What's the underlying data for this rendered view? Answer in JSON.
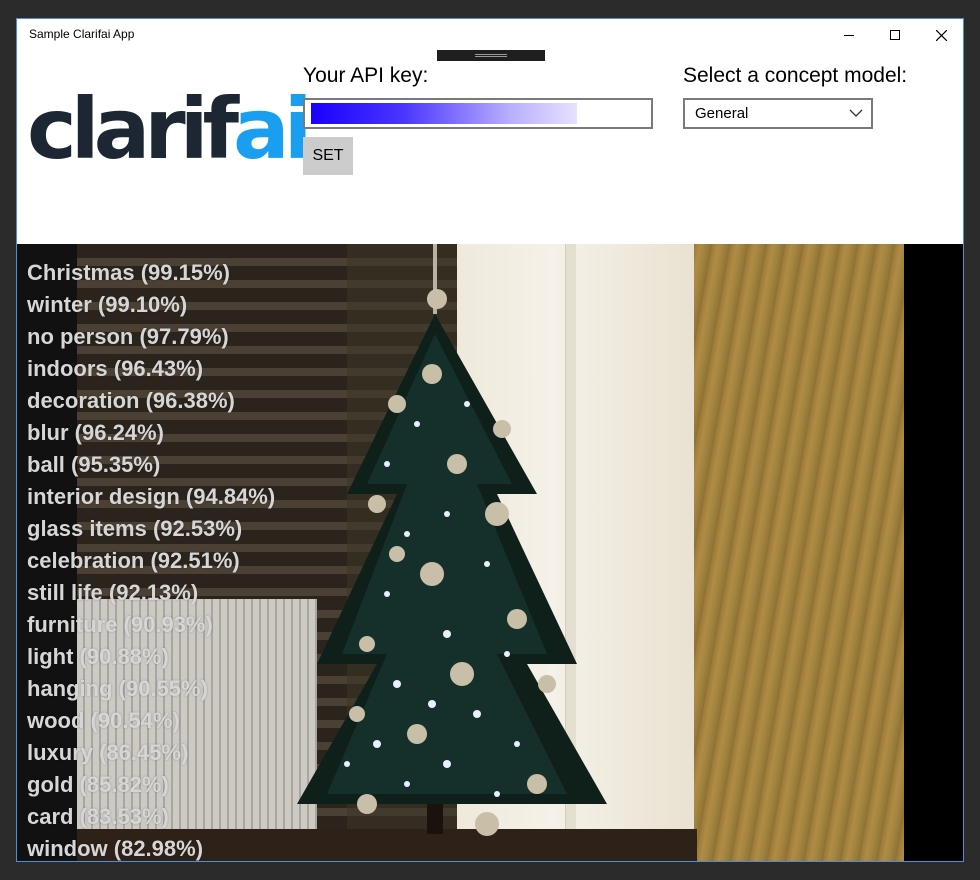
{
  "window": {
    "title": "Sample Clarifai App"
  },
  "logo": {
    "text_dark": "clarif",
    "text_blue": "ai"
  },
  "api": {
    "label": "Your API key:",
    "set_label": "SET"
  },
  "model": {
    "label": "Select a concept model:",
    "selected": "General"
  },
  "concepts": [
    "Christmas (99.15%)",
    "winter (99.10%)",
    "no person (97.79%)",
    "indoors (96.43%)",
    "decoration (96.38%)",
    "blur (96.24%)",
    "ball (95.35%)",
    "interior design (94.84%)",
    "glass items (92.53%)",
    "celebration (92.51%)",
    "still life (92.13%)",
    "furniture (90.93%)",
    "light (90.88%)",
    "hanging (90.55%)",
    "wood (90.54%)",
    "luxury (86.45%)",
    "gold (85.82%)",
    "card (83.53%)",
    "window (82.98%)"
  ],
  "colors": {
    "logo_dark": "#1d2733",
    "logo_blue": "#1a9ff0",
    "window_border": "#4a90d9",
    "button_bg": "#cccccc"
  }
}
